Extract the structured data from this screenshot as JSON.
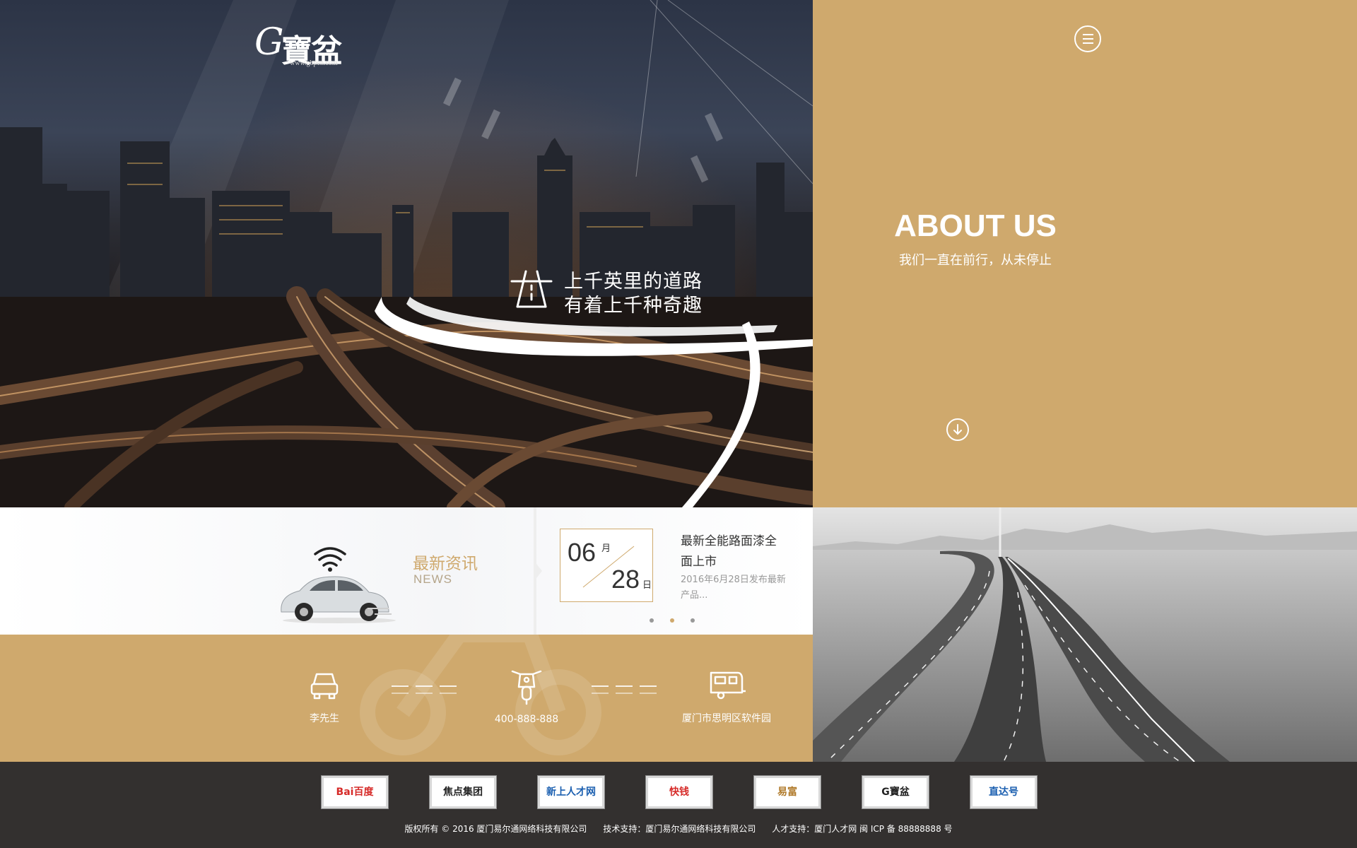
{
  "logo": {
    "mark": "G",
    "name_cn": "寶盆",
    "url": "www.gbpen.com",
    "icon": "gbpen-logo"
  },
  "hero": {
    "slogan_line1": "上千英里的道路",
    "slogan_line2": "有着上千种奇趣",
    "icon": "road-icon"
  },
  "about": {
    "title": "ABOUT US",
    "subtitle": "我们一直在前行，从未停止",
    "menu_icon": "menu-icon",
    "down_icon": "arrow-down-circle-icon",
    "accent_color": "#cfa96d"
  },
  "news": {
    "label_cn": "最新资讯",
    "label_en": "NEWS",
    "month": "06",
    "month_unit": "月",
    "day": "28",
    "day_unit": "日",
    "headline": "最新全能路面漆全面上市",
    "excerpt": "2016年6月28日发布最新产品...",
    "pager": {
      "count": 3,
      "active_index": 1
    },
    "icons": [
      "wifi-icon",
      "car-icon"
    ]
  },
  "contact": {
    "items": [
      {
        "icon": "car-front-icon",
        "text": "李先生"
      },
      {
        "icon": "motorcycle-icon",
        "text": "400-888-888"
      },
      {
        "icon": "caravan-icon",
        "text": "厦门市思明区软件园"
      }
    ]
  },
  "partners": [
    {
      "name": "Bai百度",
      "color": "#d62a28"
    },
    {
      "name": "焦点集团",
      "color": "#222222"
    },
    {
      "name": "新上人才网",
      "color": "#1b5fb0"
    },
    {
      "name": "快钱",
      "color": "#d62a28"
    },
    {
      "name": "易富",
      "color": "#b07a2a"
    },
    {
      "name": "G寶盆",
      "color": "#222222"
    },
    {
      "name": "直达号",
      "color": "#1b5fb0"
    }
  ],
  "footer": {
    "copyright": "版权所有 © 2016 厦门易尔通网络科技有限公司      技术支持：厦门易尔通网络科技有限公司      人才支持：厦门人才网 闽 ICP 备 88888888 号"
  }
}
